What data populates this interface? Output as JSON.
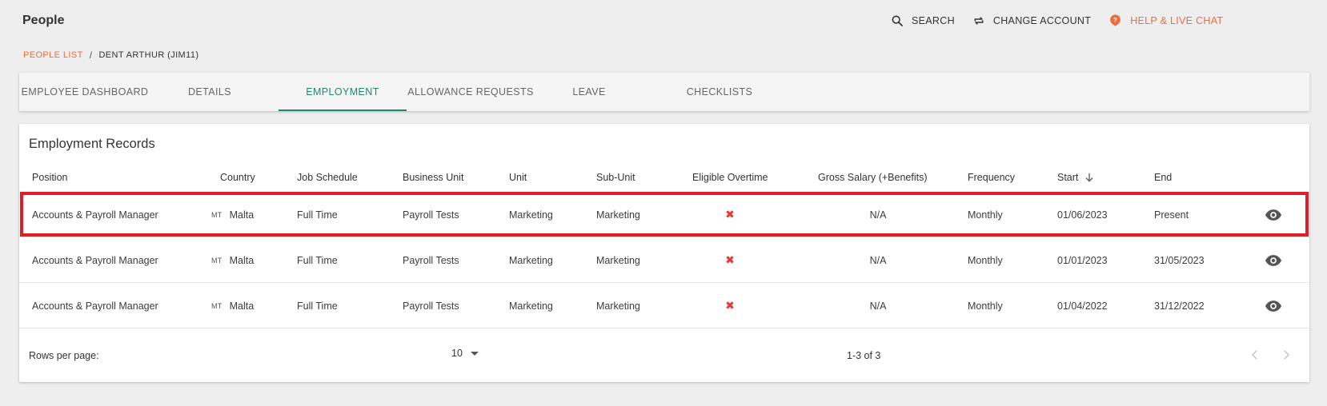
{
  "header": {
    "title": "People",
    "actions": {
      "search": "SEARCH",
      "change_account": "CHANGE ACCOUNT",
      "help": "HELP & LIVE CHAT"
    }
  },
  "breadcrumb": {
    "link": "PEOPLE LIST",
    "separator": "/",
    "current": "DENT ARTHUR (JIM11)"
  },
  "tabs": [
    {
      "label": "EMPLOYEE DASHBOARD"
    },
    {
      "label": "DETAILS"
    },
    {
      "label": "EMPLOYMENT",
      "active": true
    },
    {
      "label": "ALLOWANCE REQUESTS"
    },
    {
      "label": "LEAVE"
    },
    {
      "label": "CHECKLISTS"
    }
  ],
  "card": {
    "title": "Employment Records",
    "columns": {
      "position": "Position",
      "country": "Country",
      "job_schedule": "Job Schedule",
      "business_unit": "Business Unit",
      "unit": "Unit",
      "sub_unit": "Sub-Unit",
      "eligible_overtime": "Eligible Overtime",
      "gross_salary": "Gross Salary (+Benefits)",
      "frequency": "Frequency",
      "start": "Start",
      "end": "End"
    },
    "rows": [
      {
        "position": "Accounts & Payroll Manager",
        "country_code": "MT",
        "country": "Malta",
        "job_schedule": "Full Time",
        "business_unit": "Payroll Tests",
        "unit": "Marketing",
        "sub_unit": "Marketing",
        "eligible_overtime": "✖",
        "gross_salary": "N/A",
        "frequency": "Monthly",
        "start": "01/06/2023",
        "end": "Present"
      },
      {
        "position": "Accounts & Payroll Manager",
        "country_code": "MT",
        "country": "Malta",
        "job_schedule": "Full Time",
        "business_unit": "Payroll Tests",
        "unit": "Marketing",
        "sub_unit": "Marketing",
        "eligible_overtime": "✖",
        "gross_salary": "N/A",
        "frequency": "Monthly",
        "start": "01/01/2023",
        "end": "31/05/2023"
      },
      {
        "position": "Accounts & Payroll Manager",
        "country_code": "MT",
        "country": "Malta",
        "job_schedule": "Full Time",
        "business_unit": "Payroll Tests",
        "unit": "Marketing",
        "sub_unit": "Marketing",
        "eligible_overtime": "✖",
        "gross_salary": "N/A",
        "frequency": "Monthly",
        "start": "01/04/2022",
        "end": "31/12/2022"
      }
    ],
    "footer": {
      "rows_per_page_label": "Rows per page:",
      "rows_per_page_value": "10",
      "range": "1-3 of 3"
    }
  },
  "colors": {
    "accent_orange": "#ef6c3c",
    "active_tab": "#21876e",
    "highlight": "#e01e26",
    "x_mark": "#e53935"
  }
}
